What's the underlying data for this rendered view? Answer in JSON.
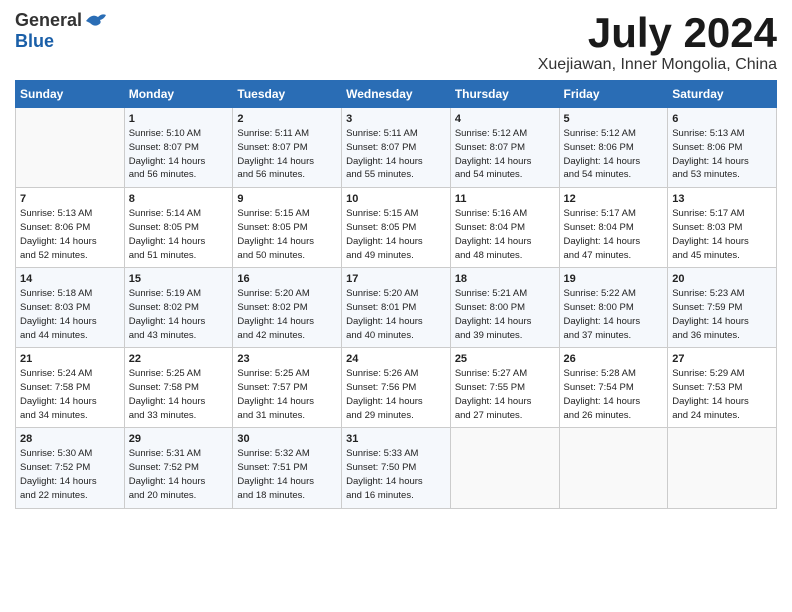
{
  "logo": {
    "general": "General",
    "blue": "Blue"
  },
  "title": "July 2024",
  "subtitle": "Xuejiawan, Inner Mongolia, China",
  "days_header": [
    "Sunday",
    "Monday",
    "Tuesday",
    "Wednesday",
    "Thursday",
    "Friday",
    "Saturday"
  ],
  "weeks": [
    [
      {
        "day": "",
        "info": ""
      },
      {
        "day": "1",
        "info": "Sunrise: 5:10 AM\nSunset: 8:07 PM\nDaylight: 14 hours\nand 56 minutes."
      },
      {
        "day": "2",
        "info": "Sunrise: 5:11 AM\nSunset: 8:07 PM\nDaylight: 14 hours\nand 56 minutes."
      },
      {
        "day": "3",
        "info": "Sunrise: 5:11 AM\nSunset: 8:07 PM\nDaylight: 14 hours\nand 55 minutes."
      },
      {
        "day": "4",
        "info": "Sunrise: 5:12 AM\nSunset: 8:07 PM\nDaylight: 14 hours\nand 54 minutes."
      },
      {
        "day": "5",
        "info": "Sunrise: 5:12 AM\nSunset: 8:06 PM\nDaylight: 14 hours\nand 54 minutes."
      },
      {
        "day": "6",
        "info": "Sunrise: 5:13 AM\nSunset: 8:06 PM\nDaylight: 14 hours\nand 53 minutes."
      }
    ],
    [
      {
        "day": "7",
        "info": "Sunrise: 5:13 AM\nSunset: 8:06 PM\nDaylight: 14 hours\nand 52 minutes."
      },
      {
        "day": "8",
        "info": "Sunrise: 5:14 AM\nSunset: 8:05 PM\nDaylight: 14 hours\nand 51 minutes."
      },
      {
        "day": "9",
        "info": "Sunrise: 5:15 AM\nSunset: 8:05 PM\nDaylight: 14 hours\nand 50 minutes."
      },
      {
        "day": "10",
        "info": "Sunrise: 5:15 AM\nSunset: 8:05 PM\nDaylight: 14 hours\nand 49 minutes."
      },
      {
        "day": "11",
        "info": "Sunrise: 5:16 AM\nSunset: 8:04 PM\nDaylight: 14 hours\nand 48 minutes."
      },
      {
        "day": "12",
        "info": "Sunrise: 5:17 AM\nSunset: 8:04 PM\nDaylight: 14 hours\nand 47 minutes."
      },
      {
        "day": "13",
        "info": "Sunrise: 5:17 AM\nSunset: 8:03 PM\nDaylight: 14 hours\nand 45 minutes."
      }
    ],
    [
      {
        "day": "14",
        "info": "Sunrise: 5:18 AM\nSunset: 8:03 PM\nDaylight: 14 hours\nand 44 minutes."
      },
      {
        "day": "15",
        "info": "Sunrise: 5:19 AM\nSunset: 8:02 PM\nDaylight: 14 hours\nand 43 minutes."
      },
      {
        "day": "16",
        "info": "Sunrise: 5:20 AM\nSunset: 8:02 PM\nDaylight: 14 hours\nand 42 minutes."
      },
      {
        "day": "17",
        "info": "Sunrise: 5:20 AM\nSunset: 8:01 PM\nDaylight: 14 hours\nand 40 minutes."
      },
      {
        "day": "18",
        "info": "Sunrise: 5:21 AM\nSunset: 8:00 PM\nDaylight: 14 hours\nand 39 minutes."
      },
      {
        "day": "19",
        "info": "Sunrise: 5:22 AM\nSunset: 8:00 PM\nDaylight: 14 hours\nand 37 minutes."
      },
      {
        "day": "20",
        "info": "Sunrise: 5:23 AM\nSunset: 7:59 PM\nDaylight: 14 hours\nand 36 minutes."
      }
    ],
    [
      {
        "day": "21",
        "info": "Sunrise: 5:24 AM\nSunset: 7:58 PM\nDaylight: 14 hours\nand 34 minutes."
      },
      {
        "day": "22",
        "info": "Sunrise: 5:25 AM\nSunset: 7:58 PM\nDaylight: 14 hours\nand 33 minutes."
      },
      {
        "day": "23",
        "info": "Sunrise: 5:25 AM\nSunset: 7:57 PM\nDaylight: 14 hours\nand 31 minutes."
      },
      {
        "day": "24",
        "info": "Sunrise: 5:26 AM\nSunset: 7:56 PM\nDaylight: 14 hours\nand 29 minutes."
      },
      {
        "day": "25",
        "info": "Sunrise: 5:27 AM\nSunset: 7:55 PM\nDaylight: 14 hours\nand 27 minutes."
      },
      {
        "day": "26",
        "info": "Sunrise: 5:28 AM\nSunset: 7:54 PM\nDaylight: 14 hours\nand 26 minutes."
      },
      {
        "day": "27",
        "info": "Sunrise: 5:29 AM\nSunset: 7:53 PM\nDaylight: 14 hours\nand 24 minutes."
      }
    ],
    [
      {
        "day": "28",
        "info": "Sunrise: 5:30 AM\nSunset: 7:52 PM\nDaylight: 14 hours\nand 22 minutes."
      },
      {
        "day": "29",
        "info": "Sunrise: 5:31 AM\nSunset: 7:52 PM\nDaylight: 14 hours\nand 20 minutes."
      },
      {
        "day": "30",
        "info": "Sunrise: 5:32 AM\nSunset: 7:51 PM\nDaylight: 14 hours\nand 18 minutes."
      },
      {
        "day": "31",
        "info": "Sunrise: 5:33 AM\nSunset: 7:50 PM\nDaylight: 14 hours\nand 16 minutes."
      },
      {
        "day": "",
        "info": ""
      },
      {
        "day": "",
        "info": ""
      },
      {
        "day": "",
        "info": ""
      }
    ]
  ]
}
